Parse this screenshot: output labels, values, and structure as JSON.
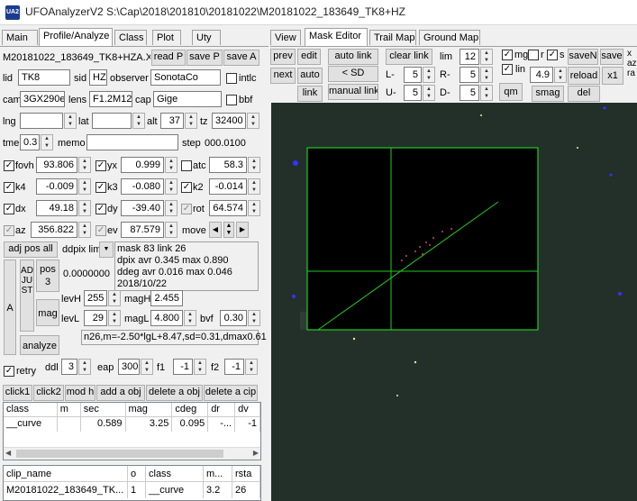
{
  "window": {
    "icon_text": "UA2",
    "title": "UFOAnalyzerV2 S:\\Cap\\2018\\201810\\20181022\\M20181022_183649_TK8+HZ"
  },
  "left_tabs": [
    "Main",
    "Profile/Analyze",
    "Class",
    "Plot",
    "Uty"
  ],
  "right_tabs": [
    "View",
    "Mask Editor",
    "Trail Map",
    "Ground Map"
  ],
  "profile": {
    "file_name": "M20181022_183649_TK8+HZA.X",
    "read_p": "read P",
    "save_p": "save P",
    "save_a": "save A",
    "lid_label": "lid",
    "lid": "TK8",
    "sid_label": "sid",
    "sid": "HZ",
    "observer_label": "observer",
    "observer": "SonotaCo",
    "intlc_label": "intlc",
    "cam_label": "cam",
    "cam": "3GX290e",
    "lens_label": "lens",
    "lens": "F1.2M12",
    "cap_label": "cap",
    "cap": "Gige",
    "bbf_label": "bbf",
    "lng_label": "lng",
    "lat_label": "lat",
    "alt_label": "alt",
    "alt": "37",
    "tz_label": "tz",
    "tz": "32400",
    "tme_label": "tme",
    "tme": "0.3",
    "memo_label": "memo",
    "step_label": "step",
    "step": "000.0100",
    "fovh_label": "fovh",
    "fovh": "93.806",
    "yx_label": "yx",
    "yx": "0.999",
    "atc_label": "atc",
    "atc": "58.3",
    "k4_label": "k4",
    "k4": "-0.009",
    "k3_label": "k3",
    "k3": "-0.080",
    "k2_label": "k2",
    "k2": "-0.014",
    "dx_label": "dx",
    "dx": "49.18",
    "dy_label": "dy",
    "dy": "-39.40",
    "rot_label": "rot",
    "rot": "64.574",
    "az_label": "az",
    "az": "356.822",
    "ev_label": "ev",
    "ev": "87.579",
    "move_label": "move",
    "adj_pos_all": "adj pos all",
    "ddpix_lim": "ddpix lim",
    "stats": [
      "mask 83  link 26",
      "dpix avr  0.345 max  0.890",
      "ddeg avr  0.016 max  0.046",
      "2018/10/22"
    ],
    "a_label": "A",
    "adjust_label": "ADJUST",
    "pos3": "pos 3",
    "pos_value": "0.0000000",
    "mag_btn": "mag",
    "analyze_btn": "analyze",
    "levH_label": "levH",
    "levH": "255",
    "magH_label": "magH",
    "magH": "2.455",
    "levL_label": "levL",
    "levL": "29",
    "magL_label": "magL",
    "magL": "4.800",
    "bvf_label": "bvf",
    "bvf": "0.30",
    "fit_result": "n26,m=-2.50*lgL+8.47,sd=0.31,dmax0.61",
    "retry_label": "retry",
    "ddl_label": "ddl",
    "ddl": "3",
    "eap_label": "eap",
    "eap": "300",
    "f1_label": "f1",
    "f1": "-1",
    "f2_label": "f2",
    "f2": "-1"
  },
  "action_buttons": [
    "click1",
    "click2",
    "mod h",
    "add a obj",
    "delete a obj",
    "delete a cip"
  ],
  "class_table": {
    "columns": [
      "class",
      "m",
      "sec",
      "mag",
      "cdeg",
      "dr",
      "dv"
    ],
    "rows": [
      [
        "__curve",
        "",
        "0.589",
        "3.25",
        "0.095",
        "-...",
        "-1"
      ]
    ]
  },
  "clip_table": {
    "columns": [
      "clip_name",
      "o",
      "class",
      "m...",
      "rsta"
    ],
    "rows": [
      [
        "M20181022_183649_TK...",
        "1",
        "__curve",
        "3.2",
        "26"
      ]
    ]
  },
  "mask_editor": {
    "prev": "prev",
    "edit": "edit",
    "auto_link": "auto link",
    "clear_link": "clear link",
    "lim_label": "lim",
    "lim": "12",
    "next": "next",
    "auto": "auto",
    "sd_btn": "< SD",
    "L_label": "L-",
    "L": "5",
    "R_label": "R-",
    "R": "5",
    "link": "link",
    "manual_link": "manual link",
    "U_label": "U-",
    "U": "5",
    "D_label": "D-",
    "D": "5",
    "mg_label": "mg",
    "r_label": "r",
    "s_label": "s",
    "saveN": "saveN",
    "save": "save",
    "lin_label": "lin",
    "lin_value": "4.9",
    "reload": "reload",
    "x1": "x1",
    "qm": "qm",
    "smag": "smag",
    "del": "del",
    "x_label": "x",
    "az_label": "az",
    "ra_label": "ra"
  },
  "colors": {
    "image_bg": "#23302a",
    "plot_bg": "#000000",
    "plot_line": "#22cc22",
    "star": "#3333ff",
    "accent_tab": "#ffffff"
  }
}
